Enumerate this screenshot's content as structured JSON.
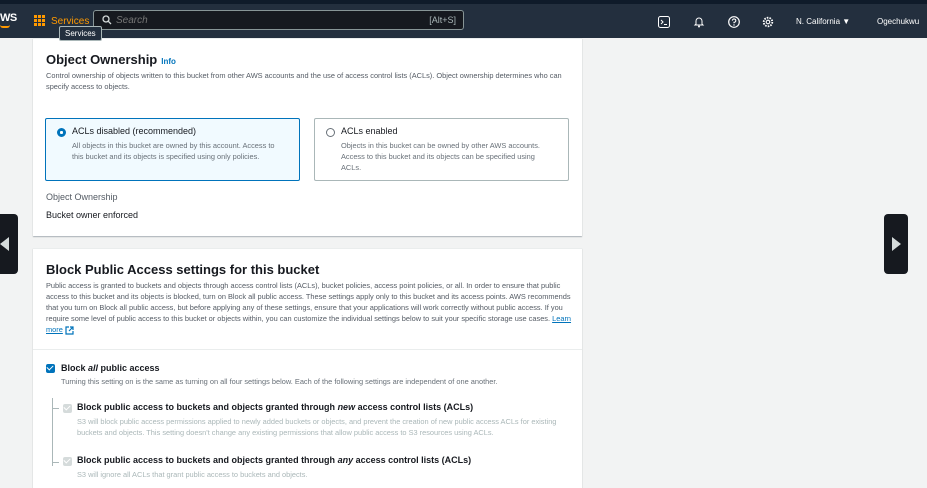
{
  "topnav": {
    "logo_text": "WS",
    "services_label": "Services",
    "services_tooltip": "Services",
    "search_placeholder": "Search",
    "search_shortcut": "[Alt+S]",
    "region": "N. California ▼",
    "user": "Ogechukwu"
  },
  "object_ownership": {
    "title": "Object Ownership",
    "info_link": "Info",
    "description": "Control ownership of objects written to this bucket from other AWS accounts and the use of access control lists (ACLs). Object ownership determines who can specify access to objects.",
    "options": [
      {
        "label": "ACLs disabled (recommended)",
        "description": "All objects in this bucket are owned by this account. Access to this bucket and its objects is specified using only policies.",
        "selected": true
      },
      {
        "label": "ACLs enabled",
        "description": "Objects in this bucket can be owned by other AWS accounts. Access to this bucket and its objects can be specified using ACLs.",
        "selected": false
      }
    ],
    "setting_key": "Object Ownership",
    "setting_value": "Bucket owner enforced"
  },
  "block_public_access": {
    "title": "Block Public Access settings for this bucket",
    "description": "Public access is granted to buckets and objects through access control lists (ACLs), bucket policies, access point policies, or all. In order to ensure that public access to this bucket and its objects is blocked, turn on Block all public access. These settings apply only to this bucket and its access points. AWS recommends that you turn on Block all public access, but before applying any of these settings, ensure that your applications will work correctly without public access. If you require some level of public access to this bucket or objects within, you can customize the individual settings below to suit your specific storage use cases.",
    "learn_more": "Learn more",
    "block_all": {
      "label_pre": "Block ",
      "label_em": "all",
      "label_post": " public access",
      "description": "Turning this setting on is the same as turning on all four settings below. Each of the following settings are independent of one another.",
      "checked": true
    },
    "settings": [
      {
        "label_pre": "Block public access to buckets and objects granted through ",
        "label_em": "new",
        "label_post": " access control lists (ACLs)",
        "description": "S3 will block public access permissions applied to newly added buckets or objects, and prevent the creation of new public access ACLs for existing buckets and objects. This setting doesn't change any existing permissions that allow public access to S3 resources using ACLs."
      },
      {
        "label_pre": "Block public access to buckets and objects granted through ",
        "label_em": "any",
        "label_post": " access control lists (ACLs)",
        "description": "S3 will ignore all ACLs that grant public access to buckets and objects."
      }
    ]
  },
  "colors": {
    "nav_bg": "#232f3e",
    "accent": "#ff9900",
    "link": "#0073bb",
    "selected_bg": "#f1faff"
  }
}
